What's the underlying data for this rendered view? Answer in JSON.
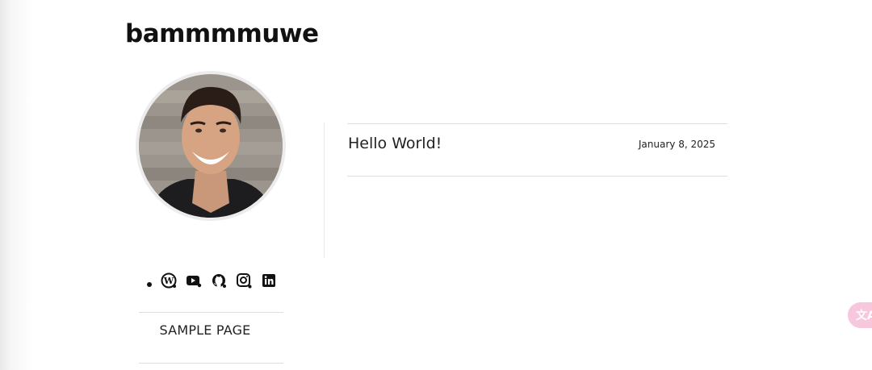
{
  "site": {
    "title": "bammmmuwe"
  },
  "avatar": {
    "alt": "profile photo"
  },
  "social": {
    "icons": [
      "dot-icon",
      "wordpress-icon",
      "youtube-icon",
      "github-icon",
      "instagram-icon",
      "linkedin-icon"
    ]
  },
  "nav": {
    "items": [
      {
        "label": "SAMPLE PAGE"
      }
    ]
  },
  "posts": [
    {
      "title": "Hello World!",
      "date": "January 8, 2025"
    }
  ],
  "floating": {
    "icon": "translate-icon",
    "color": "#f6c7dd"
  }
}
